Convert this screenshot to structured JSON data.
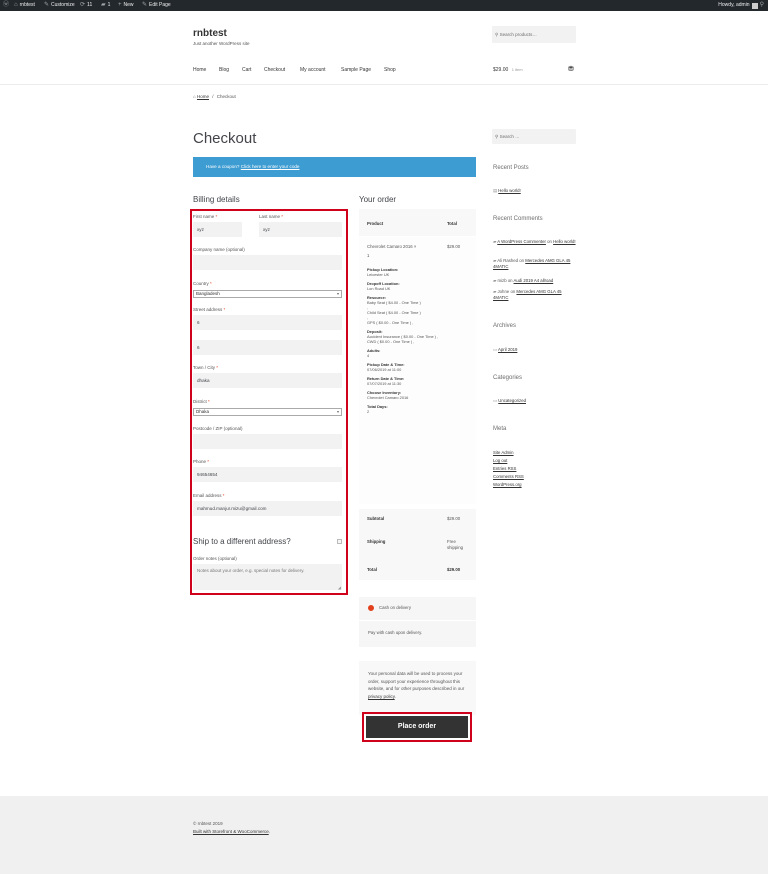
{
  "admin_bar": {
    "site_name": "rnbtest",
    "customize": "Customize",
    "updates_count": "11",
    "comments_count": "1",
    "new": "New",
    "edit_page": "Edit Page",
    "howdy": "Howdy, admin"
  },
  "header": {
    "site_title": "rnbtest",
    "tagline": "Just another WordPress site",
    "search_placeholder": "Search products…",
    "nav": [
      "Home",
      "Blog",
      "Cart",
      "Checkout",
      "My account",
      "Sample Page",
      "Shop"
    ],
    "cart_total": "$29.00",
    "cart_items": "1 item"
  },
  "breadcrumb": {
    "home": "Home",
    "separator": "/",
    "current": "Checkout"
  },
  "page_title": "Checkout",
  "coupon": {
    "text": "Have a coupon?",
    "link": "Click here to enter your code"
  },
  "billing": {
    "title": "Billing details",
    "first_name_label": "First name",
    "first_name": "xyz",
    "last_name_label": "Last name",
    "last_name": "xyz",
    "company_label": "Company name (optional)",
    "country_label": "Country",
    "country": "Bangladesh",
    "street_label": "Street address",
    "street1": "6",
    "street2": "6",
    "city_label": "Town / City",
    "city": "dhaka",
    "district_label": "District",
    "district": "Dhaka",
    "postcode_label": "Postcode / ZIP (optional)",
    "phone_label": "Phone",
    "phone": "94654654",
    "email_label": "Email address",
    "email": "mahmud.manjur.mizu@gmail.com",
    "required_mark": "*",
    "ship_different": "Ship to a different address?",
    "order_notes_label": "Order notes (optional)",
    "order_notes_placeholder": "Notes about your order, e.g. special notes for delivery."
  },
  "order": {
    "title": "Your order",
    "col_product": "Product",
    "col_total": "Total",
    "product_name": "Chevrolet Camaro 2016",
    "product_qty_mark": "×",
    "product_qty": "1",
    "product_total": "$29.00",
    "details": [
      {
        "label": "Pickup Location:",
        "value": "Leicester UK"
      },
      {
        "label": "Dropoff Location:",
        "value": "Lon Road UK"
      },
      {
        "label": "Resource:",
        "value": "Baby Seat ( $4.00 - One Time )"
      },
      {
        "label": "",
        "value": "Child Seat ( $4.00 - One Time )"
      },
      {
        "label": "",
        "value": "GPS ( $0.00 - One Time ) ,"
      },
      {
        "label": "Deposit:",
        "value": "Accident Insurance ( $0.00 - One Time ) ,"
      },
      {
        "label": "",
        "value": "CWD ( $0.00 - One Time ) ,"
      },
      {
        "label": "Adults:",
        "value": "4"
      },
      {
        "label": "Pickup Date & Time:",
        "value": "07/06/2019 at 11:00"
      },
      {
        "label": "Return Date & Time:",
        "value": "07/07/2019 at 11:30"
      },
      {
        "label": "Choose Inventory:",
        "value": "Chevrolet Camaro 2016"
      },
      {
        "label": "Total Days:",
        "value": "2"
      }
    ],
    "subtotal_label": "Subtotal",
    "subtotal": "$29.00",
    "shipping_label": "Shipping",
    "shipping": "Free shipping",
    "total_label": "Total",
    "total": "$29.00",
    "payment_method": "Cash on delivery",
    "payment_desc": "Pay with cash upon delivery.",
    "privacy_text": "Your personal data will be used to process your order, support your experience throughout this website, and for other purposes described in our",
    "privacy_link": "privacy policy",
    "privacy_end": ".",
    "place_order": "Place order"
  },
  "sidebar": {
    "search_placeholder": "Search …",
    "recent_posts_title": "Recent Posts",
    "recent_posts": [
      "Hello world!"
    ],
    "recent_comments_title": "Recent Comments",
    "comments": [
      {
        "author": "A WordPress Commenter",
        "on": "on",
        "post": "Hello world!"
      },
      {
        "author": "Ali Rashed",
        "on": "on",
        "post": "Mercedes AMG GLA 45 4MATIC"
      },
      {
        "author": "mizb",
        "on": "on",
        "post": "Audi 2019 A4 allroad"
      },
      {
        "author": "Johne",
        "on": "on",
        "post": "Mercedes AMG GLA 45 4MATIC"
      }
    ],
    "archives_title": "Archives",
    "archives": [
      "April 2019"
    ],
    "categories_title": "Categories",
    "categories": [
      "Uncategorized"
    ],
    "meta_title": "Meta",
    "meta": [
      "Site Admin",
      "Log out",
      "Entries RSS",
      "Comments RSS",
      "WordPress.org"
    ]
  },
  "footer": {
    "copyright": "© rnbtest 2019",
    "built_with": "Built with Storefront & WooCommerce",
    "built_end": "."
  }
}
